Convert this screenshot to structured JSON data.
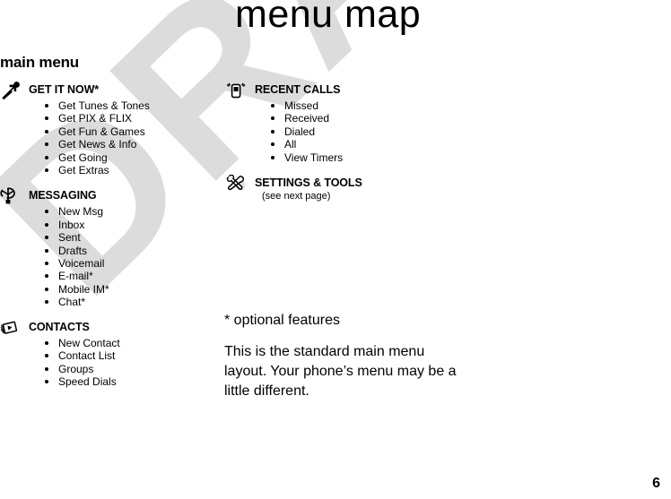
{
  "page": {
    "title": "menu map",
    "section_label": "main menu",
    "page_number": "6",
    "watermark_text": "DRAFT",
    "watermark_color": "#dcdcdc",
    "text_color": "#000000",
    "background_color": "#ffffff"
  },
  "columns": {
    "left": [
      {
        "icon": "arrow-up-right-dot-icon",
        "title": "GET IT NOW*",
        "items": [
          "Get Tunes & Tones",
          "Get PIX & FLIX",
          "Get Fun & Games",
          "Get News & Info",
          "Get Going",
          "Get Extras"
        ]
      },
      {
        "icon": "envelope-message-icon",
        "title": "MESSAGING",
        "items": [
          "New Msg",
          "Inbox",
          "Sent",
          "Drafts",
          "Voicemail",
          "E-mail*",
          "Mobile IM*",
          "Chat*"
        ]
      },
      {
        "icon": "contact-cards-icon",
        "title": "CONTACTS",
        "items": [
          "New Contact",
          "Contact List",
          "Groups",
          "Speed Dials"
        ]
      }
    ],
    "right": [
      {
        "icon": "mobile-phone-signal-icon",
        "title": "RECENT CALLS",
        "items": [
          "Missed",
          "Received",
          "Dialed",
          "All",
          "View Timers"
        ]
      },
      {
        "icon": "tools-hammer-wrench-icon",
        "title": "SETTINGS & TOOLS",
        "note": "(see next page)",
        "items": []
      }
    ]
  },
  "notes": {
    "optional": "* optional features",
    "body": "This is the standard main menu layout. Your phone’s menu may be a little different."
  }
}
